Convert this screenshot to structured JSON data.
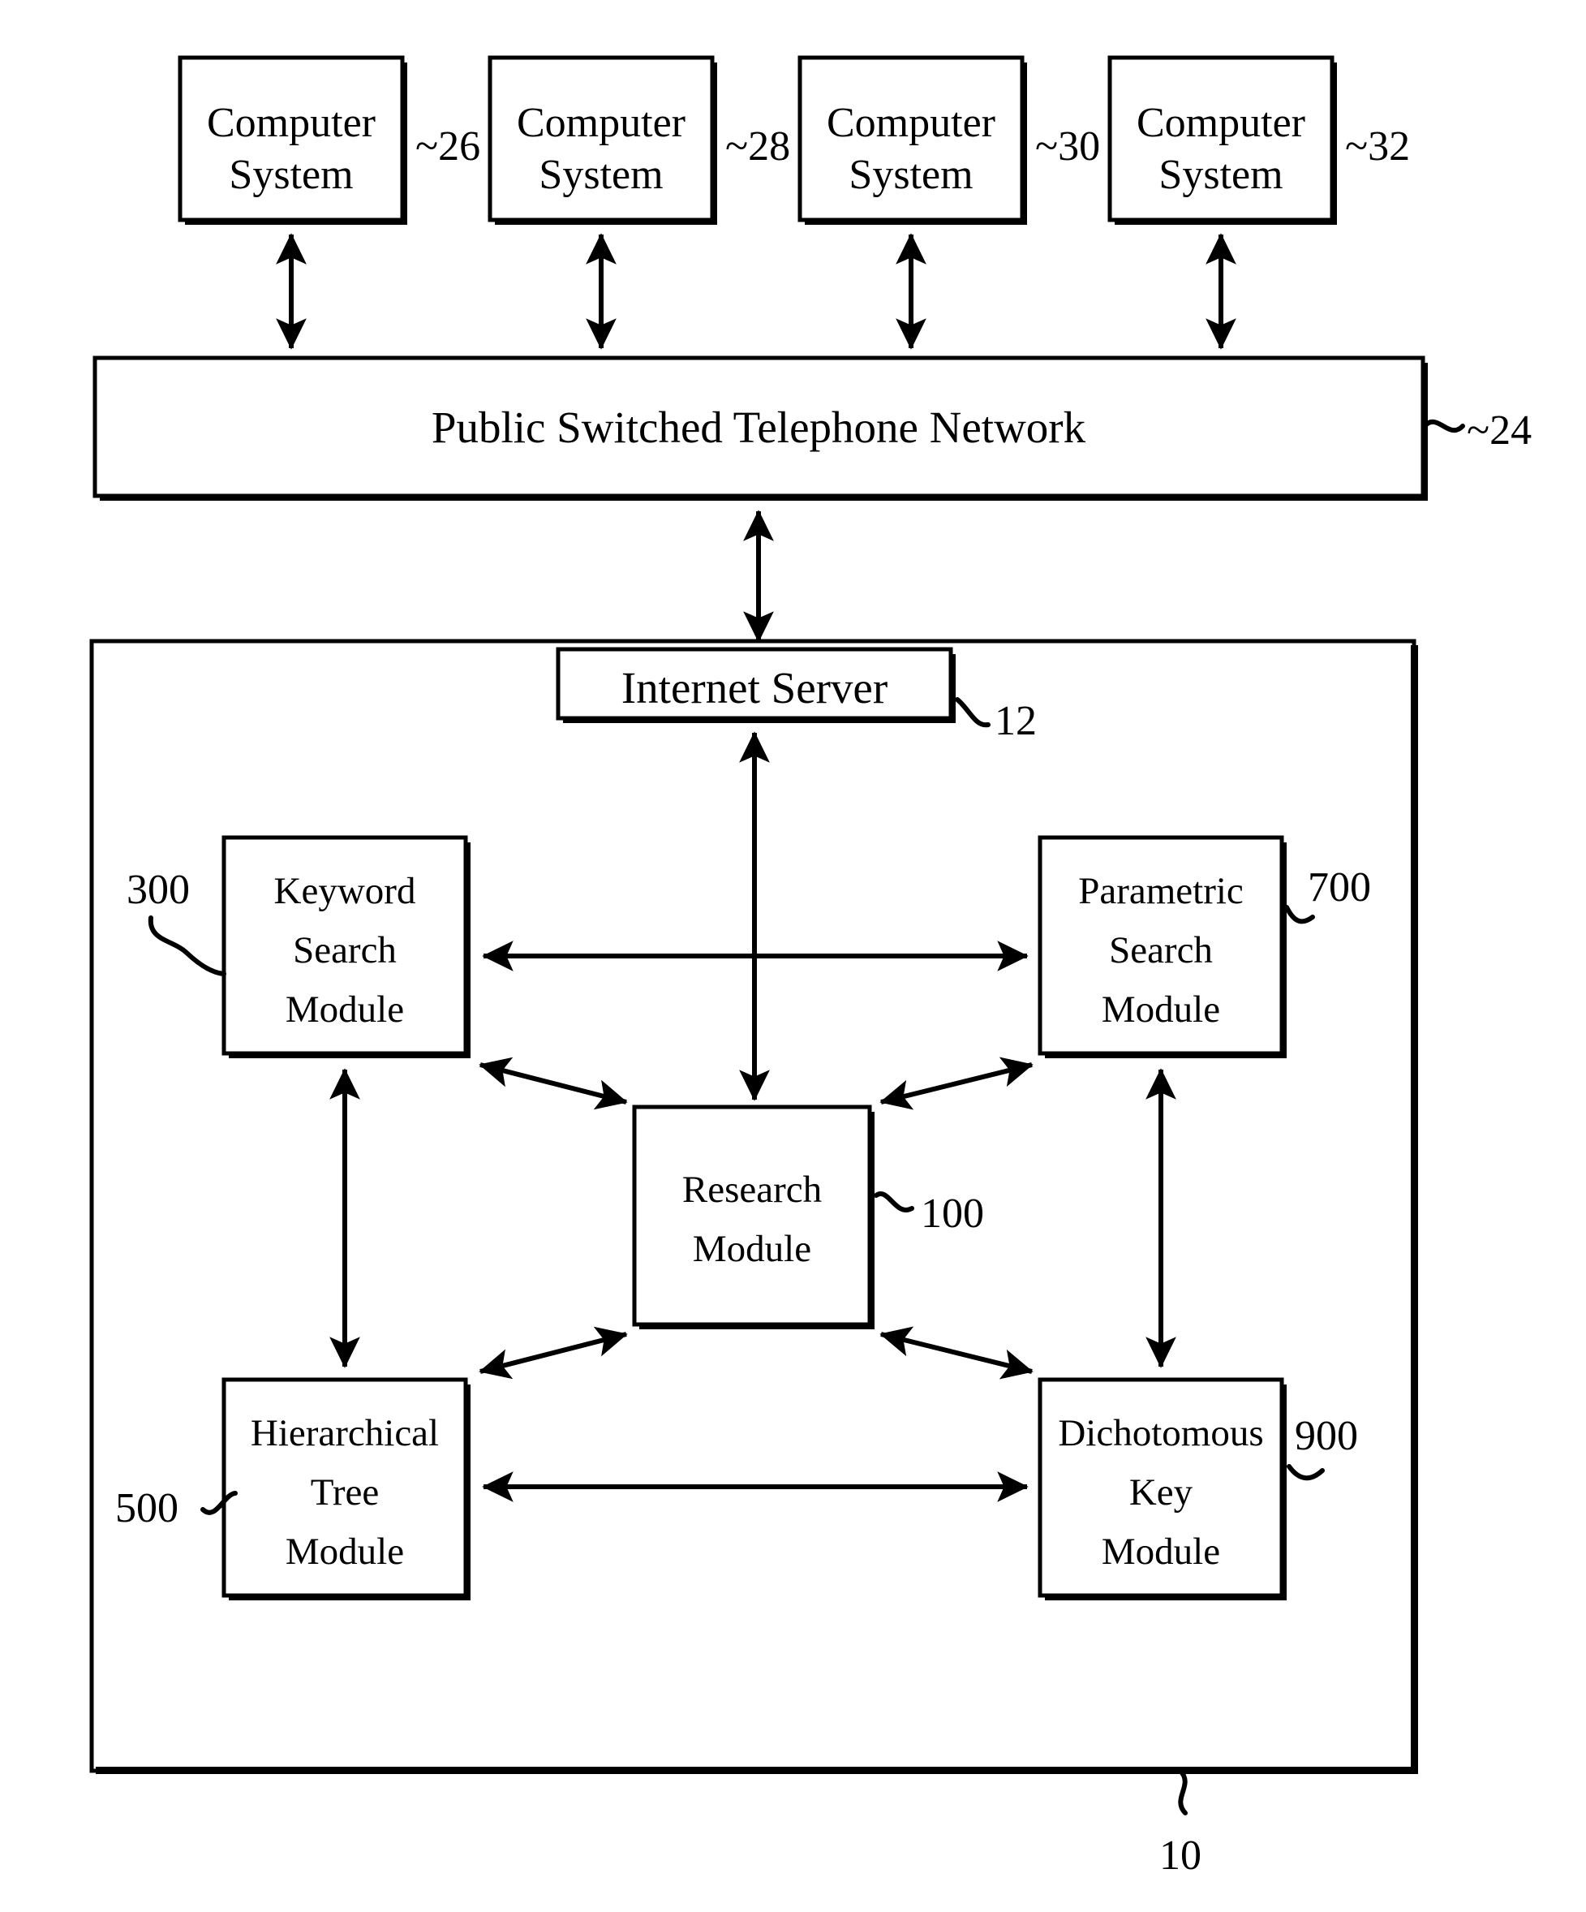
{
  "figure": {
    "kind": "patent-block-diagram",
    "system_ref": "10"
  },
  "terminals": [
    {
      "id": "cs26",
      "line1": "Computer",
      "line2": "System",
      "ref": "~26"
    },
    {
      "id": "cs28",
      "line1": "Computer",
      "line2": "System",
      "ref": "~28"
    },
    {
      "id": "cs30",
      "line1": "Computer",
      "line2": "System",
      "ref": "~30"
    },
    {
      "id": "cs32",
      "line1": "Computer",
      "line2": "System",
      "ref": "~32"
    }
  ],
  "network": {
    "label": "Public Switched Telephone Network",
    "ref": "~24"
  },
  "server": {
    "label": "Internet Server",
    "ref": "12"
  },
  "modules": [
    {
      "id": "keyword",
      "lines": [
        "Keyword",
        "Search",
        "Module"
      ],
      "ref": "300"
    },
    {
      "id": "parametric",
      "lines": [
        "Parametric",
        "Search",
        "Module"
      ],
      "ref": "700"
    },
    {
      "id": "research",
      "lines": [
        "Research",
        "Module"
      ],
      "ref": "100"
    },
    {
      "id": "hierarchical",
      "lines": [
        "Hierarchical",
        "Tree",
        "Module"
      ],
      "ref": "500"
    },
    {
      "id": "dichotomous",
      "lines": [
        "Dichotomous",
        "Key",
        "Module"
      ],
      "ref": "900"
    }
  ],
  "system_container": {
    "ref": "10"
  },
  "colors": {
    "ink": "#000000",
    "paper": "#ffffff"
  }
}
